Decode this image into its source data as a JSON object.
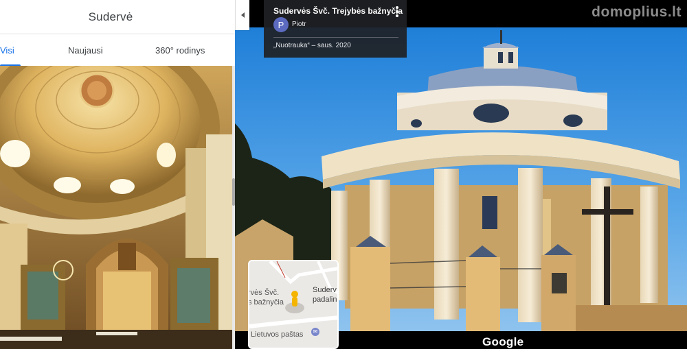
{
  "left_panel": {
    "title": "Sudervė",
    "tabs": [
      {
        "label": "Visi",
        "active": true
      },
      {
        "label": "Naujausi",
        "active": false
      },
      {
        "label": "360° rodinys",
        "active": false
      }
    ]
  },
  "info_card": {
    "title": "Sudervės Švč. Trejybės bažnyčia",
    "author_initial": "P",
    "author_name": "Piotr",
    "date": "„Nuotrauka“ – saus. 2020"
  },
  "watermark": "domoplius.lt",
  "minimap": {
    "labels": [
      "rvės Švč.",
      "s bažnyčia",
      "Suderv",
      "padalin",
      "Lietuvos paštas"
    ]
  },
  "footer": {
    "logo": "Google"
  },
  "colors": {
    "accent": "#1a73e8",
    "card_bg": "#202124",
    "avatar": "#5c6bc0"
  }
}
